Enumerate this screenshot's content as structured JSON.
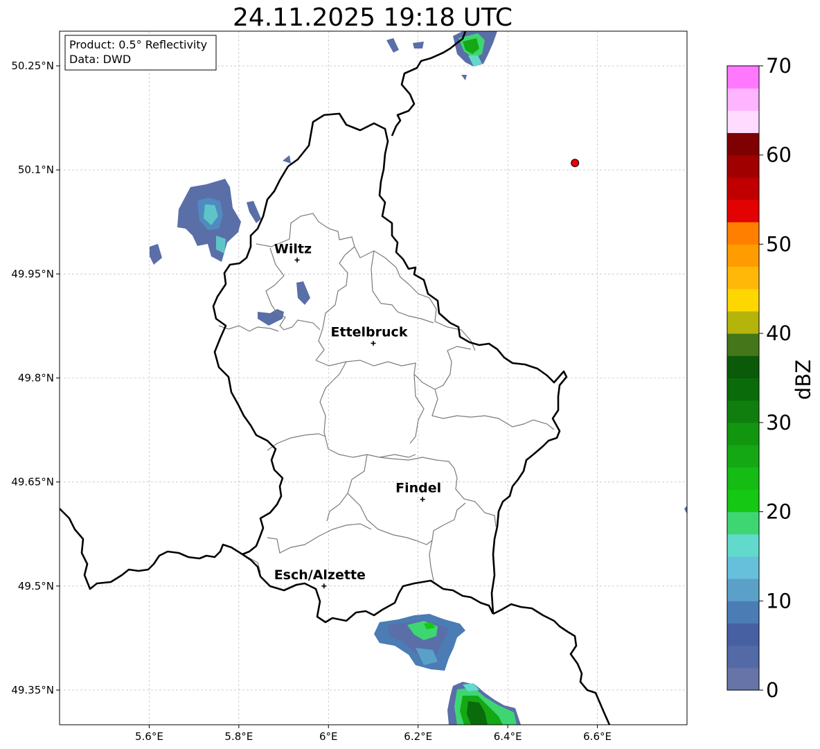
{
  "title": "24.11.2025 19:18 UTC",
  "info_box": {
    "line1": "Product: 0.5° Reflectivity",
    "line2": "Data: DWD"
  },
  "axes": {
    "lon_ticks": [
      "5.6°E",
      "5.8°E",
      "6°E",
      "6.2°E",
      "6.4°E",
      "6.6°E"
    ],
    "lat_ticks": [
      "50.25°N",
      "50.1°N",
      "49.95°N",
      "49.8°N",
      "49.65°N",
      "49.5°N",
      "49.35°N"
    ],
    "lon_values": [
      5.6,
      5.8,
      6.0,
      6.2,
      6.4,
      6.6
    ],
    "lat_values": [
      50.25,
      50.1,
      49.95,
      49.8,
      49.65,
      49.5,
      49.35
    ],
    "lon_range": [
      5.4,
      6.8
    ],
    "lat_range": [
      49.3,
      50.3
    ],
    "grid": true
  },
  "cities": [
    {
      "name": "Wiltz",
      "lon": 5.93,
      "lat": 49.97
    },
    {
      "name": "Ettelbruck",
      "lon": 6.1,
      "lat": 49.85
    },
    {
      "name": "Findel",
      "lon": 6.21,
      "lat": 49.625
    },
    {
      "name": "Esch/Alzette",
      "lon": 5.99,
      "lat": 49.5
    }
  ],
  "radar_site": {
    "lon": 6.55,
    "lat": 50.11,
    "color": "#e8000b"
  },
  "colorbar": {
    "label": "dBZ",
    "ticks": [
      "0",
      "10",
      "20",
      "30",
      "40",
      "50",
      "60",
      "70"
    ],
    "tick_values": [
      0,
      10,
      20,
      30,
      40,
      50,
      60,
      70
    ],
    "range": [
      0,
      70
    ],
    "step": 2.5,
    "colors": [
      "#6674a8",
      "#546aa6",
      "#4660a2",
      "#4b7cb4",
      "#5aa0c8",
      "#66c0dc",
      "#62dacb",
      "#3ed672",
      "#14c814",
      "#14bc14",
      "#14a814",
      "#12960f",
      "#107e0e",
      "#0a6b0a",
      "#0a5a0a",
      "#45761a",
      "#b4b40a",
      "#ffd700",
      "#ffb808",
      "#ff9c00",
      "#ff8000",
      "#e20202",
      "#c00000",
      "#a00000",
      "#7e0000",
      "#ffdcff",
      "#ffb4ff",
      "#ff78ff",
      "#ee3cee"
    ]
  },
  "colors": {
    "border": "#000000",
    "commune": "#7a7a7a",
    "grid": "#b0b0b0"
  }
}
